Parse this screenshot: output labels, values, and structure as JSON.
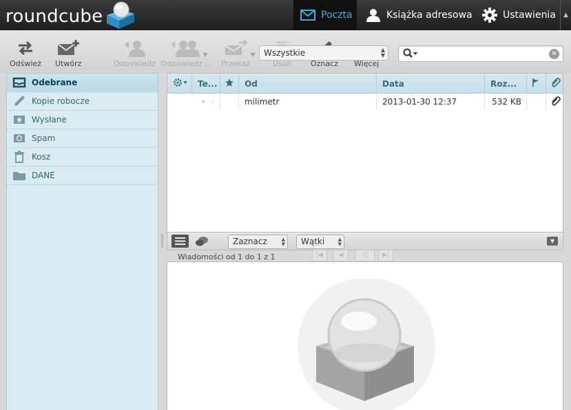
{
  "app": {
    "logo_text": "roundcube"
  },
  "topnav": {
    "mail": "Poczta",
    "contacts": "Książka adresowa",
    "settings": "Ustawienia"
  },
  "toolbar": {
    "refresh": "Odśwież",
    "compose": "Utwórz",
    "reply": "Odpowiedz",
    "reply_all": "Odpowiedz ...",
    "forward": "Przekaż",
    "delete": "Usuń",
    "mark": "Oznacz",
    "more": "Więcej",
    "filter_value": "Wszystkie",
    "search_value": ""
  },
  "folders": [
    {
      "label": "Odebrane",
      "icon": "inbox-icon",
      "selected": true
    },
    {
      "label": "Kopie robocze",
      "icon": "pencil-icon",
      "selected": false
    },
    {
      "label": "Wysłane",
      "icon": "sent-icon",
      "selected": false
    },
    {
      "label": "Spam",
      "icon": "spam-icon",
      "selected": false
    },
    {
      "label": "Kosz",
      "icon": "trash-icon",
      "selected": false
    },
    {
      "label": "DANE",
      "icon": "folder-icon",
      "selected": false
    }
  ],
  "list": {
    "columns": {
      "thread": "Te...",
      "from": "Od",
      "date": "Data",
      "size": "Roz..."
    },
    "rows": [
      {
        "from": "milimetr",
        "date": "2013-01-30 12:37",
        "size": "532 KB",
        "attachment": true
      }
    ]
  },
  "list_footer": {
    "select": "Zaznacz",
    "threads": "Wątki",
    "count_text": "Wiadomości od 1 do 1 z 1"
  },
  "colors": {
    "accent": "#34b4e3",
    "folder_bg": "#d9ecf4",
    "header_text": "#3a6d80"
  }
}
